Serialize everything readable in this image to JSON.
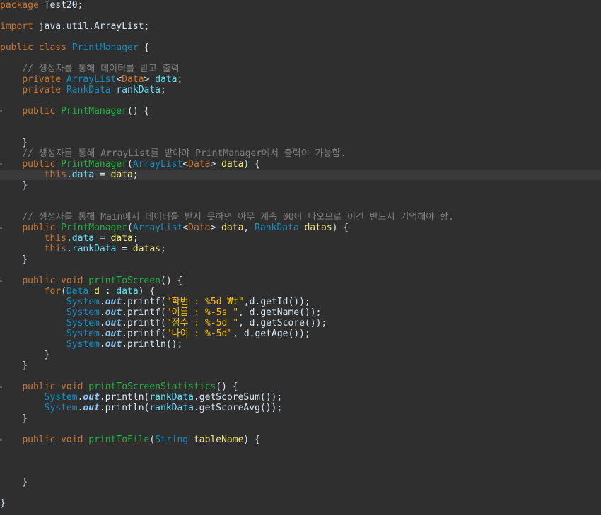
{
  "editor": {
    "language": "java",
    "theme_colors": {
      "background": "#2f2f2f",
      "current_line": "#3a3a3a",
      "keyword": "#cc7832",
      "type": "#1290c3",
      "method": "#1eb540",
      "variable": "#f3ec79",
      "field": "#66e1f8",
      "comment": "#808080",
      "string": "#ffc600"
    },
    "lines": [
      {
        "row": 0,
        "tokens": [
          {
            "c": "kw",
            "t": "package"
          },
          {
            "c": "pl",
            "t": " Test20;"
          }
        ]
      },
      {
        "row": 2,
        "tokens": [
          {
            "c": "kw",
            "t": "import"
          },
          {
            "c": "pl",
            "t": " java.util.ArrayList;"
          }
        ]
      },
      {
        "row": 4,
        "tokens": [
          {
            "c": "kw",
            "t": "public"
          },
          {
            "c": "pl",
            "t": " "
          },
          {
            "c": "kw",
            "t": "class"
          },
          {
            "c": "pl",
            "t": " "
          },
          {
            "c": "tp",
            "t": "PrintManager"
          },
          {
            "c": "pl",
            "t": " {"
          }
        ]
      },
      {
        "row": 6,
        "tokens": [
          {
            "c": "pl",
            "t": "    "
          },
          {
            "c": "cm",
            "t": "// 생성자를 통해 데이터를 받고 출력"
          }
        ]
      },
      {
        "row": 7,
        "tokens": [
          {
            "c": "pl",
            "t": "    "
          },
          {
            "c": "kw",
            "t": "private"
          },
          {
            "c": "pl",
            "t": " "
          },
          {
            "c": "tp",
            "t": "ArrayList"
          },
          {
            "c": "pl",
            "t": "<"
          },
          {
            "c": "ta",
            "t": "Data"
          },
          {
            "c": "pl",
            "t": "> "
          },
          {
            "c": "fd",
            "t": "data"
          },
          {
            "c": "pl",
            "t": ";"
          }
        ]
      },
      {
        "row": 8,
        "tokens": [
          {
            "c": "pl",
            "t": "    "
          },
          {
            "c": "kw",
            "t": "private"
          },
          {
            "c": "pl",
            "t": " "
          },
          {
            "c": "tp",
            "t": "RankData"
          },
          {
            "c": "pl",
            "t": " "
          },
          {
            "c": "fd",
            "t": "rankData"
          },
          {
            "c": "pl",
            "t": ";"
          }
        ]
      },
      {
        "row": 10,
        "mark": true,
        "tokens": [
          {
            "c": "pl",
            "t": "    "
          },
          {
            "c": "kw",
            "t": "public"
          },
          {
            "c": "pl",
            "t": " "
          },
          {
            "c": "fn",
            "t": "PrintManager"
          },
          {
            "c": "pl",
            "t": "() {"
          }
        ]
      },
      {
        "row": 13,
        "tokens": [
          {
            "c": "pl",
            "t": "    }"
          }
        ]
      },
      {
        "row": 14,
        "tokens": [
          {
            "c": "pl",
            "t": "    "
          },
          {
            "c": "cm",
            "t": "// 생성자를 통해 ArrayList를 받아야 PrintManager에서 출력이 가능함."
          }
        ]
      },
      {
        "row": 15,
        "mark": true,
        "tokens": [
          {
            "c": "pl",
            "t": "    "
          },
          {
            "c": "kw",
            "t": "public"
          },
          {
            "c": "pl",
            "t": " "
          },
          {
            "c": "fn",
            "t": "PrintManager"
          },
          {
            "c": "pl",
            "t": "("
          },
          {
            "c": "tp",
            "t": "ArrayList"
          },
          {
            "c": "pl",
            "t": "<"
          },
          {
            "c": "ta",
            "t": "Data"
          },
          {
            "c": "pl",
            "t": "> "
          },
          {
            "c": "vr",
            "t": "data"
          },
          {
            "c": "pl",
            "t": ") {"
          }
        ]
      },
      {
        "row": 16,
        "current": true,
        "cursor": true,
        "tokens": [
          {
            "c": "pl",
            "t": "        "
          },
          {
            "c": "kw",
            "t": "this"
          },
          {
            "c": "pl",
            "t": "."
          },
          {
            "c": "fd",
            "t": "data"
          },
          {
            "c": "pl",
            "t": " = "
          },
          {
            "c": "vr",
            "t": "data"
          },
          {
            "c": "pl",
            "t": ";"
          }
        ]
      },
      {
        "row": 17,
        "tokens": [
          {
            "c": "pl",
            "t": "    }"
          }
        ]
      },
      {
        "row": 20,
        "tokens": [
          {
            "c": "pl",
            "t": "    "
          },
          {
            "c": "cm",
            "t": "// 생성자를 통해 Main에서 데이터를 받지 못하면 아무 계속 00이 나오므로 이건 반드시 기억해야 함."
          }
        ]
      },
      {
        "row": 21,
        "mark": true,
        "tokens": [
          {
            "c": "pl",
            "t": "    "
          },
          {
            "c": "kw",
            "t": "public"
          },
          {
            "c": "pl",
            "t": " "
          },
          {
            "c": "fn",
            "t": "PrintManager"
          },
          {
            "c": "pl",
            "t": "("
          },
          {
            "c": "tp",
            "t": "ArrayList"
          },
          {
            "c": "pl",
            "t": "<"
          },
          {
            "c": "ta",
            "t": "Data"
          },
          {
            "c": "pl",
            "t": "> "
          },
          {
            "c": "vr",
            "t": "data"
          },
          {
            "c": "pl",
            "t": ", "
          },
          {
            "c": "tp",
            "t": "RankData"
          },
          {
            "c": "pl",
            "t": " "
          },
          {
            "c": "vr",
            "t": "datas"
          },
          {
            "c": "pl",
            "t": ") {"
          }
        ]
      },
      {
        "row": 22,
        "tokens": [
          {
            "c": "pl",
            "t": "        "
          },
          {
            "c": "kw",
            "t": "this"
          },
          {
            "c": "pl",
            "t": "."
          },
          {
            "c": "fd",
            "t": "data"
          },
          {
            "c": "pl",
            "t": " = "
          },
          {
            "c": "vr",
            "t": "data"
          },
          {
            "c": "pl",
            "t": ";"
          }
        ]
      },
      {
        "row": 23,
        "tokens": [
          {
            "c": "pl",
            "t": "        "
          },
          {
            "c": "kw",
            "t": "this"
          },
          {
            "c": "pl",
            "t": "."
          },
          {
            "c": "fd",
            "t": "rankData"
          },
          {
            "c": "pl",
            "t": " = "
          },
          {
            "c": "vr",
            "t": "datas"
          },
          {
            "c": "pl",
            "t": ";"
          }
        ]
      },
      {
        "row": 24,
        "tokens": [
          {
            "c": "pl",
            "t": "    }"
          }
        ]
      },
      {
        "row": 26,
        "mark": true,
        "tokens": [
          {
            "c": "pl",
            "t": "    "
          },
          {
            "c": "kw",
            "t": "public"
          },
          {
            "c": "pl",
            "t": " "
          },
          {
            "c": "kw",
            "t": "void"
          },
          {
            "c": "pl",
            "t": " "
          },
          {
            "c": "fn",
            "t": "printToScreen"
          },
          {
            "c": "pl",
            "t": "() {"
          }
        ]
      },
      {
        "row": 27,
        "tokens": [
          {
            "c": "pl",
            "t": "        "
          },
          {
            "c": "kw",
            "t": "for"
          },
          {
            "c": "pl",
            "t": "("
          },
          {
            "c": "tp",
            "t": "Data"
          },
          {
            "c": "pl",
            "t": " "
          },
          {
            "c": "vr",
            "t": "d"
          },
          {
            "c": "pl",
            "t": " : "
          },
          {
            "c": "fd",
            "t": "data"
          },
          {
            "c": "pl",
            "t": ") {"
          }
        ]
      },
      {
        "row": 28,
        "tokens": [
          {
            "c": "pl",
            "t": "            "
          },
          {
            "c": "sy",
            "t": "System"
          },
          {
            "c": "pl",
            "t": "."
          },
          {
            "c": "so",
            "t": "out"
          },
          {
            "c": "pl",
            "t": ".printf("
          },
          {
            "c": "st",
            "t": "\"학번 : %5d ₩t\""
          },
          {
            "c": "pl",
            "t": ",d.getId());"
          }
        ]
      },
      {
        "row": 29,
        "tokens": [
          {
            "c": "pl",
            "t": "            "
          },
          {
            "c": "sy",
            "t": "System"
          },
          {
            "c": "pl",
            "t": "."
          },
          {
            "c": "so",
            "t": "out"
          },
          {
            "c": "pl",
            "t": ".printf("
          },
          {
            "c": "st",
            "t": "\"이름 : %-5s \""
          },
          {
            "c": "pl",
            "t": ", d.getName());"
          }
        ]
      },
      {
        "row": 30,
        "tokens": [
          {
            "c": "pl",
            "t": "            "
          },
          {
            "c": "sy",
            "t": "System"
          },
          {
            "c": "pl",
            "t": "."
          },
          {
            "c": "so",
            "t": "out"
          },
          {
            "c": "pl",
            "t": ".printf("
          },
          {
            "c": "st",
            "t": "\"점수 : %-5d \""
          },
          {
            "c": "pl",
            "t": ", d.getScore());"
          }
        ]
      },
      {
        "row": 31,
        "tokens": [
          {
            "c": "pl",
            "t": "            "
          },
          {
            "c": "sy",
            "t": "System"
          },
          {
            "c": "pl",
            "t": "."
          },
          {
            "c": "so",
            "t": "out"
          },
          {
            "c": "pl",
            "t": ".printf("
          },
          {
            "c": "st",
            "t": "\"나이 : %-5d\""
          },
          {
            "c": "pl",
            "t": ", d.getAge());"
          }
        ]
      },
      {
        "row": 32,
        "tokens": [
          {
            "c": "pl",
            "t": "            "
          },
          {
            "c": "sy",
            "t": "System"
          },
          {
            "c": "pl",
            "t": "."
          },
          {
            "c": "so",
            "t": "out"
          },
          {
            "c": "pl",
            "t": ".println();"
          }
        ]
      },
      {
        "row": 33,
        "tokens": [
          {
            "c": "pl",
            "t": "        }"
          }
        ]
      },
      {
        "row": 34,
        "tokens": [
          {
            "c": "pl",
            "t": "    }"
          }
        ]
      },
      {
        "row": 36,
        "mark": true,
        "tokens": [
          {
            "c": "pl",
            "t": "    "
          },
          {
            "c": "kw",
            "t": "public"
          },
          {
            "c": "pl",
            "t": " "
          },
          {
            "c": "kw",
            "t": "void"
          },
          {
            "c": "pl",
            "t": " "
          },
          {
            "c": "fn",
            "t": "printToScreenStatistics"
          },
          {
            "c": "pl",
            "t": "() {"
          }
        ]
      },
      {
        "row": 37,
        "tokens": [
          {
            "c": "pl",
            "t": "        "
          },
          {
            "c": "sy",
            "t": "System"
          },
          {
            "c": "pl",
            "t": "."
          },
          {
            "c": "so",
            "t": "out"
          },
          {
            "c": "pl",
            "t": ".println("
          },
          {
            "c": "fd",
            "t": "rankData"
          },
          {
            "c": "pl",
            "t": ".getScoreSum());"
          }
        ]
      },
      {
        "row": 38,
        "tokens": [
          {
            "c": "pl",
            "t": "        "
          },
          {
            "c": "sy",
            "t": "System"
          },
          {
            "c": "pl",
            "t": "."
          },
          {
            "c": "so",
            "t": "out"
          },
          {
            "c": "pl",
            "t": ".println("
          },
          {
            "c": "fd",
            "t": "rankData"
          },
          {
            "c": "pl",
            "t": ".getScoreAvg());"
          }
        ]
      },
      {
        "row": 39,
        "tokens": [
          {
            "c": "pl",
            "t": "    }"
          }
        ]
      },
      {
        "row": 41,
        "mark": true,
        "tokens": [
          {
            "c": "pl",
            "t": "    "
          },
          {
            "c": "kw",
            "t": "public"
          },
          {
            "c": "pl",
            "t": " "
          },
          {
            "c": "kw",
            "t": "void"
          },
          {
            "c": "pl",
            "t": " "
          },
          {
            "c": "fn",
            "t": "printToFile"
          },
          {
            "c": "pl",
            "t": "("
          },
          {
            "c": "tp",
            "t": "String"
          },
          {
            "c": "pl",
            "t": " "
          },
          {
            "c": "vr",
            "t": "tableName"
          },
          {
            "c": "pl",
            "t": ") {"
          }
        ]
      },
      {
        "row": 45,
        "tokens": [
          {
            "c": "pl",
            "t": "    }"
          }
        ]
      },
      {
        "row": 47,
        "tokens": [
          {
            "c": "pl",
            "t": "}"
          }
        ]
      }
    ]
  }
}
